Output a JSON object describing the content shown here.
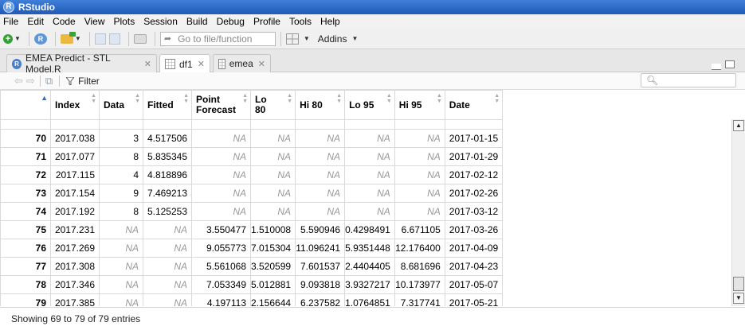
{
  "app": {
    "title": "RStudio",
    "logo_letter": "R"
  },
  "menu": [
    "File",
    "Edit",
    "Code",
    "View",
    "Plots",
    "Session",
    "Build",
    "Debug",
    "Profile",
    "Tools",
    "Help"
  ],
  "toolbar": {
    "goto_placeholder": "Go to file/function",
    "addins_label": "Addins"
  },
  "tabs": [
    {
      "label": "EMEA Predict - STL Model.R",
      "icon": "r-script-icon",
      "active": false
    },
    {
      "label": "df1",
      "icon": "table-icon",
      "active": true
    },
    {
      "label": "emea",
      "icon": "table-icon",
      "active": false
    }
  ],
  "viewer": {
    "filter_label": "Filter",
    "search_placeholder": ""
  },
  "grid": {
    "columns": [
      {
        "label": "",
        "sort": "asc"
      },
      {
        "label": "Index",
        "sort": "both"
      },
      {
        "label": "Data",
        "sort": "both"
      },
      {
        "label": "Fitted",
        "sort": "both"
      },
      {
        "label": "Point\nForecast",
        "sort": "both"
      },
      {
        "label": "Lo\n80",
        "sort": "both"
      },
      {
        "label": "Hi 80",
        "sort": "both"
      },
      {
        "label": "Lo 95",
        "sort": "both"
      },
      {
        "label": "Hi 95",
        "sort": "both"
      },
      {
        "label": "Date",
        "sort": "both"
      }
    ],
    "rows": [
      [
        "70",
        "2017.038",
        "3",
        "4.517506",
        "NA",
        "NA",
        "NA",
        "NA",
        "NA",
        "2017-01-15"
      ],
      [
        "71",
        "2017.077",
        "8",
        "5.835345",
        "NA",
        "NA",
        "NA",
        "NA",
        "NA",
        "2017-01-29"
      ],
      [
        "72",
        "2017.115",
        "4",
        "4.818896",
        "NA",
        "NA",
        "NA",
        "NA",
        "NA",
        "2017-02-12"
      ],
      [
        "73",
        "2017.154",
        "9",
        "7.469213",
        "NA",
        "NA",
        "NA",
        "NA",
        "NA",
        "2017-02-26"
      ],
      [
        "74",
        "2017.192",
        "8",
        "5.125253",
        "NA",
        "NA",
        "NA",
        "NA",
        "NA",
        "2017-03-12"
      ],
      [
        "75",
        "2017.231",
        "NA",
        "NA",
        "3.550477",
        "1.510008",
        "5.590946",
        "0.4298491",
        "6.671105",
        "2017-03-26"
      ],
      [
        "76",
        "2017.269",
        "NA",
        "NA",
        "9.055773",
        "7.015304",
        "11.096241",
        "5.9351448",
        "12.176400",
        "2017-04-09"
      ],
      [
        "77",
        "2017.308",
        "NA",
        "NA",
        "5.561068",
        "3.520599",
        "7.601537",
        "2.4404405",
        "8.681696",
        "2017-04-23"
      ],
      [
        "78",
        "2017.346",
        "NA",
        "NA",
        "7.053349",
        "5.012881",
        "9.093818",
        "3.9327217",
        "10.173977",
        "2017-05-07"
      ],
      [
        "79",
        "2017.385",
        "NA",
        "NA",
        "4.197113",
        "2.156644",
        "6.237582",
        "1.0764851",
        "7.317741",
        "2017-05-21"
      ]
    ]
  },
  "status": {
    "text": "Showing 69 to 79 of 79 entries"
  }
}
